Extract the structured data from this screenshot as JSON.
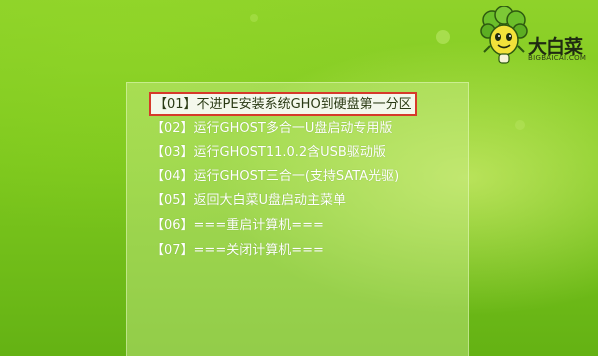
{
  "logo": {
    "title": "大白菜",
    "subtitle": "BIGBAICAI.COM"
  },
  "menu": {
    "items": [
      {
        "label": "【01】不进PE安装系统GHO到硬盘第一分区",
        "selected": true
      },
      {
        "label": "【02】运行GHOST多合一U盘启动专用版",
        "selected": false
      },
      {
        "label": "【03】运行GHOST11.0.2含USB驱动版",
        "selected": false
      },
      {
        "label": "【04】运行GHOST三合一(支持SATA光驱)",
        "selected": false
      },
      {
        "label": "【05】返回大白菜U盘启动主菜单",
        "selected": false
      },
      {
        "label": "【06】===重启计算机===",
        "selected": false
      },
      {
        "label": "【07】===关闭计算机===",
        "selected": false
      }
    ]
  },
  "colors": {
    "background": "#7ec81e",
    "selection_border": "#d63a2a",
    "selection_fill": "#f4f8ec",
    "menu_text": "#ffffff"
  }
}
